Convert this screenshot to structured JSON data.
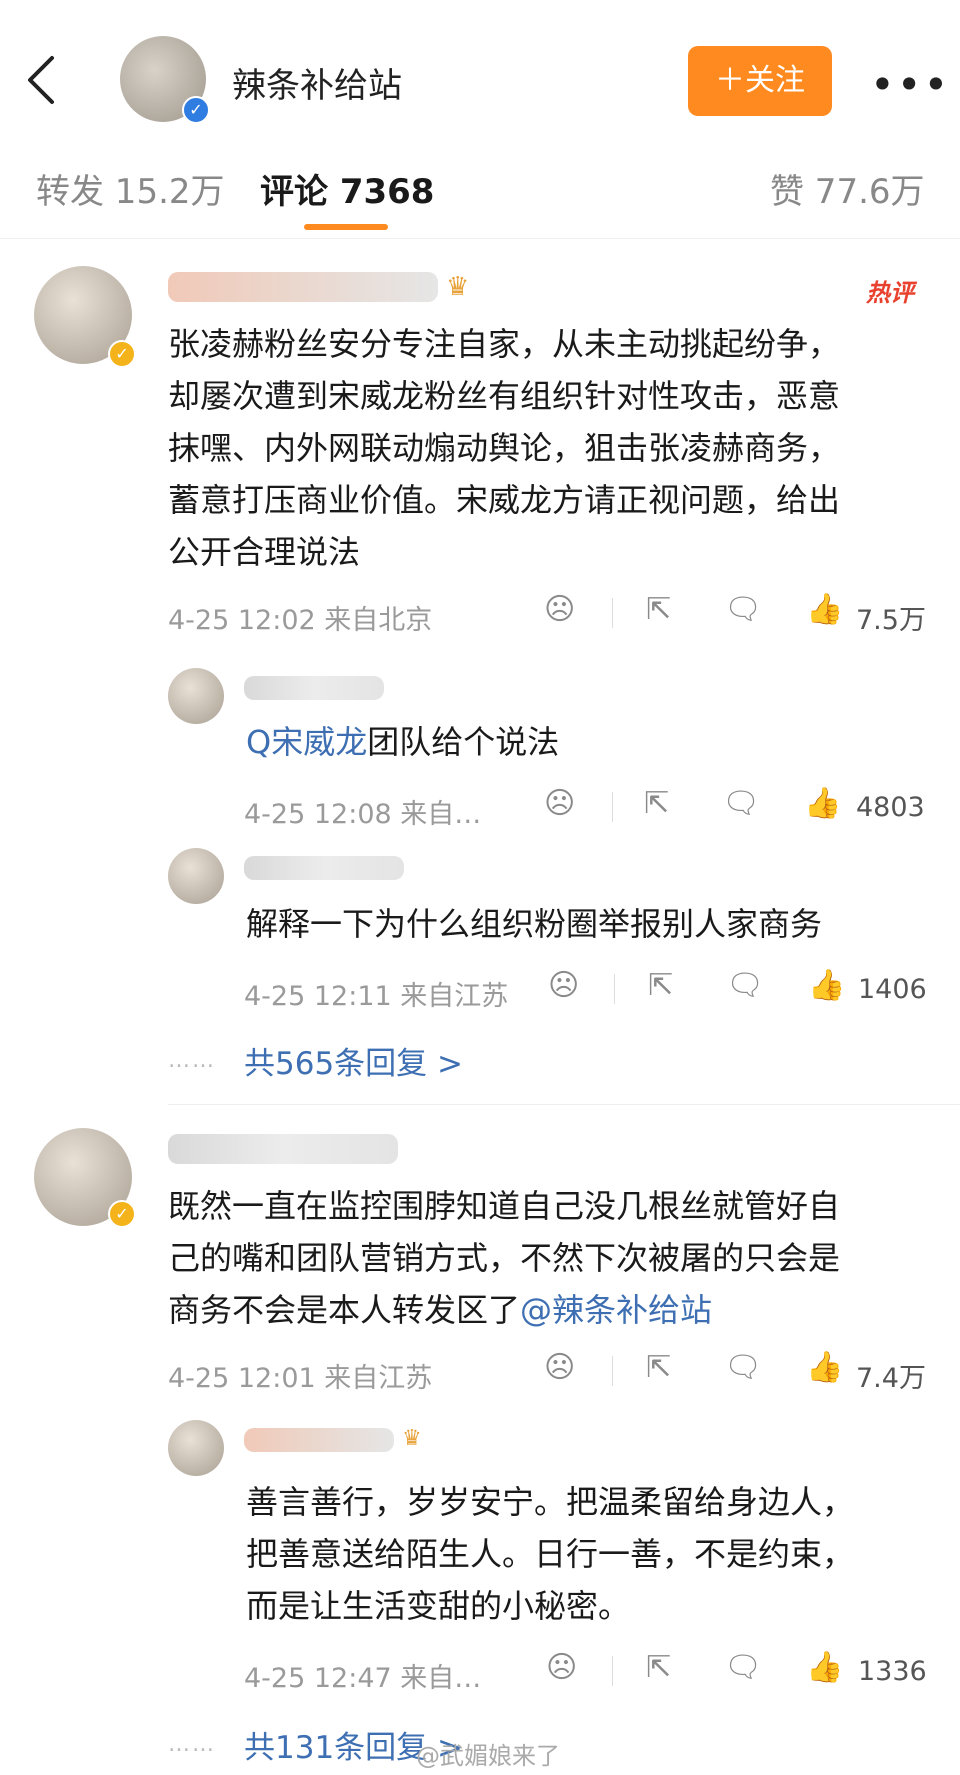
{
  "header": {
    "account_name": "辣条补给站",
    "follow_label": "＋关注",
    "more_label": "•••"
  },
  "tabs": [
    {
      "label": "转发 15.2万"
    },
    {
      "label": "评论 7368"
    },
    {
      "label": "赞 77.6万"
    }
  ],
  "hot_badge": "热评",
  "comments": [
    {
      "text": "张凌赫粉丝安分专注自家，从未主动挑起纷争，却屡次遭到宋威龙粉丝有组织针对性攻击，恶意抹嘿、内外网联动煽动舆论，狙击张凌赫商务，蓄意打压商业价值。宋威龙方请正视问题，给出公开合理说法",
      "lines": [
        "张凌赫粉丝安分专注自家，从未主动挑起纷争，",
        "却屡次遭到宋威龙粉丝有组织针对性攻击，恶意",
        "抹嘿、内外网联动煽动舆论，狙击张凌赫商务，",
        "蓄意打压商业价值。宋威龙方请正视问题，给出",
        "公开合理说法"
      ],
      "meta": "4-25 12:02  来自北京",
      "likes": "7.5万",
      "replies": [
        {
          "link": "Q宋威龙",
          "text": "团队给个说法",
          "meta": "4-25 12:08  来自…",
          "likes": "4803"
        },
        {
          "text": "解释一下为什么组织粉圈举报别人家商务",
          "meta": "4-25 12:11  来自江苏",
          "likes": "1406"
        }
      ],
      "more_replies": "共565条回复 >"
    },
    {
      "lines": [
        "既然一直在监控围脖知道自己没几根丝就管好自",
        "己的嘴和团队营销方式，不然下次被屠的只会是",
        "商务不会是本人转发区了"
      ],
      "mention": "@辣条补给站",
      "meta": "4-25 12:01  来自江苏",
      "likes": "7.4万",
      "replies": [
        {
          "lines": [
            "善言善行，岁岁安宁。把温柔留给身边人，",
            "把善意送给陌生人。日行一善，不是约束，",
            "而是让生活变甜的小秘密。"
          ],
          "meta": "4-25 12:47  来自…",
          "likes": "1336"
        }
      ],
      "more_replies": "共131条回复 >"
    }
  ],
  "icons": {
    "back": "back-chevron-icon",
    "dislike": "sad-face-icon",
    "share": "share-icon",
    "comment": "comment-bubble-icon",
    "like": "thumbs-up-icon"
  },
  "watermark": "@武媚娘来了",
  "dots": "……",
  "accent_color": "#ff8a1f"
}
